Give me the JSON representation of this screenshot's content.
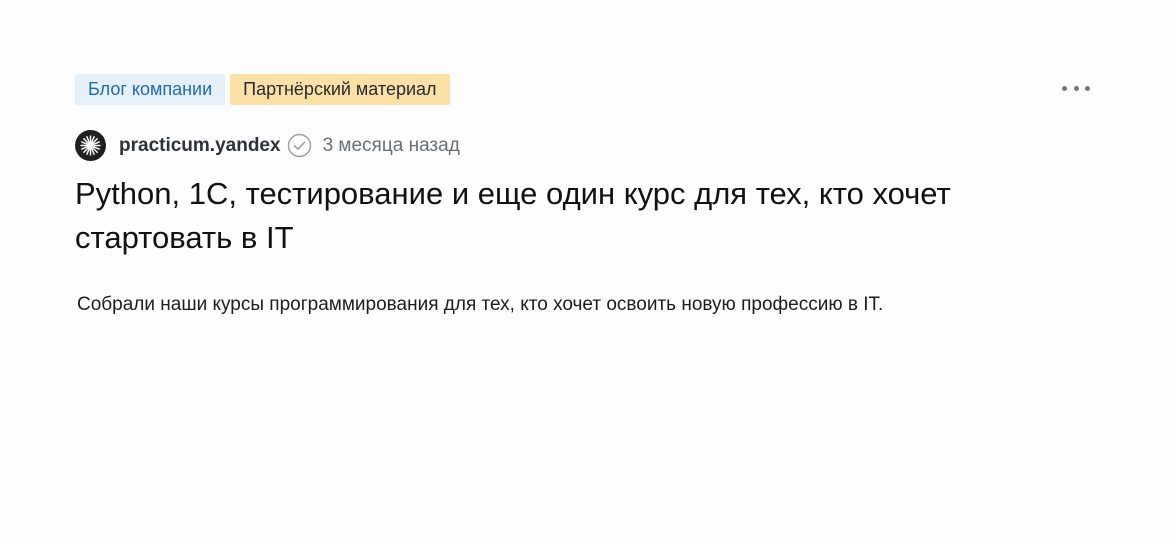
{
  "tags": {
    "blog": "Блог компании",
    "partner": "Партнёрский материал"
  },
  "post": {
    "author": "practicum.yandex",
    "time": "3 месяца назад",
    "title": "Python, 1С, тестирование и еще один курс для тех, кто хочет стартовать в IT",
    "lead": "Собрали наши курсы программирования для тех, кто хочет освоить новую профессию в IT."
  },
  "icons": {
    "avatar": "practicum-logo-icon",
    "verified": "verified-check-icon",
    "more": "more-dots-icon"
  },
  "colors": {
    "blog_tag_bg": "#e5f0f9",
    "blog_tag_text": "#226ca3",
    "partner_tag_bg": "#fbe1a8"
  }
}
